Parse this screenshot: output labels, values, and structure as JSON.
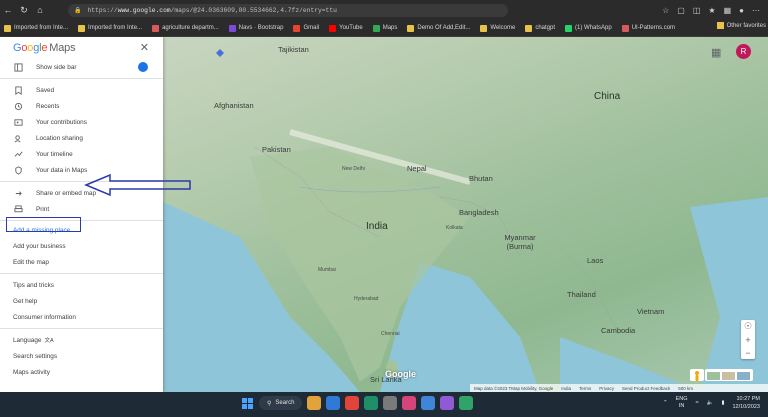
{
  "browser": {
    "url_prefix": "https://",
    "url_host": "www.google.com",
    "url_path": "/maps/@24.0363609,80.5534662,4.7fz/entry=ttu"
  },
  "bookmarks": [
    {
      "label": "Imported from Inte...",
      "color": "#e8c34a"
    },
    {
      "label": "Imported from Inte...",
      "color": "#e8c34a"
    },
    {
      "label": "agriculture departm...",
      "color": "#d85a5a"
    },
    {
      "label": "Navs · Bootstrap",
      "color": "#7b4ad9"
    },
    {
      "label": "Gmail",
      "color": "#ea4335"
    },
    {
      "label": "YouTube",
      "color": "#ff0000"
    },
    {
      "label": "Maps",
      "color": "#34a853"
    },
    {
      "label": "Demo Of Add,Edit...",
      "color": "#e8c34a"
    },
    {
      "label": "Welcome",
      "color": "#e8c34a"
    },
    {
      "label": "chatgpt",
      "color": "#e8c34a"
    },
    {
      "label": "(1) WhatsApp",
      "color": "#25d366"
    },
    {
      "label": "UI-Patterns.com",
      "color": "#d85a5a"
    }
  ],
  "bookmarks_more": "Other favorites",
  "sidebar": {
    "logo_letters": [
      "G",
      "o",
      "o",
      "g",
      "l",
      "e"
    ],
    "logo_suffix": "Maps",
    "show_side_bar": "Show side bar",
    "items_group1": [
      "Saved",
      "Recents",
      "Your contributions",
      "Location sharing",
      "Your timeline",
      "Your data in Maps"
    ],
    "items_group2": [
      "Share or embed map",
      "Print"
    ],
    "items_group3": [
      "Add a missing place",
      "Add your business",
      "Edit the map"
    ],
    "items_group4": [
      "Tips and tricks",
      "Get help",
      "Consumer information"
    ],
    "items_group5": [
      "Language",
      "Search settings",
      "Maps activity"
    ],
    "language_glyph": "文A"
  },
  "map": {
    "labels_big": [
      "China",
      "India"
    ],
    "labels_country": [
      "Tajikistan",
      "Afghanistan",
      "Pakistan",
      "Nepal",
      "Bhutan",
      "Bangladesh",
      "Myanmar (Burma)",
      "Laos",
      "Thailand",
      "Vietnam",
      "Cambodia",
      "Sri Lanka"
    ],
    "labels_city": [
      "New Delhi",
      "Kolkata",
      "Hyderabad",
      "Chennai",
      "Mumbai"
    ],
    "watermark": "Google",
    "attribution": [
      "Map data ©2023 TMap Mobility, Google",
      "India",
      "Terms",
      "Privacy",
      "Send Product Feedback",
      "500 km"
    ],
    "avatar_letter": "R"
  },
  "taskbar": {
    "search_label": "Search",
    "lang_top": "ENG",
    "lang_bottom": "IN",
    "time": "10:27 PM",
    "date": "12/10/2023"
  }
}
